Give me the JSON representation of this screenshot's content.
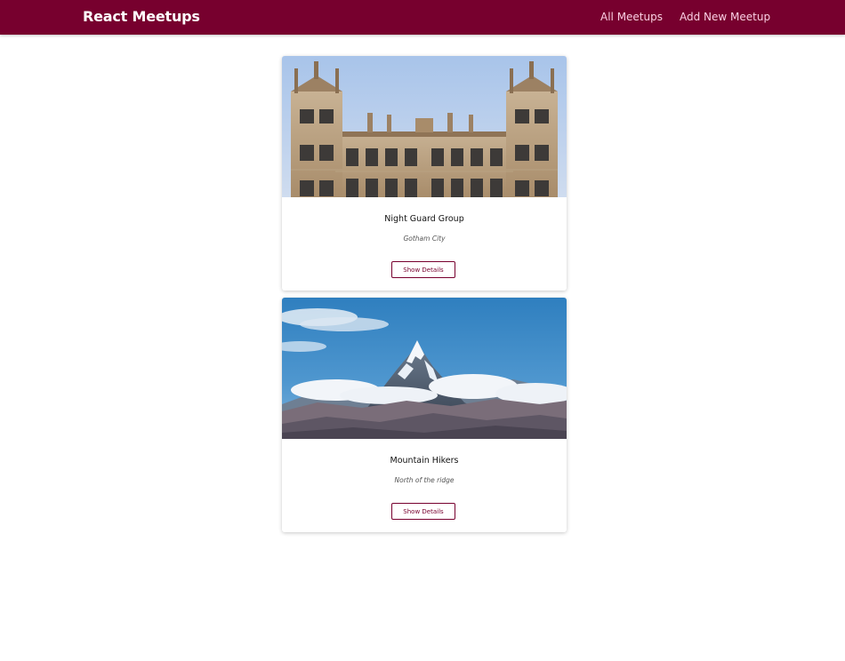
{
  "header": {
    "logo": "React Meetups",
    "nav": {
      "all_meetups": "All Meetups",
      "add_new_meetup": "Add New Meetup"
    }
  },
  "meetups": [
    {
      "title": "Night Guard Group",
      "address": "Gotham City",
      "button_label": "Show Details",
      "image_description": "castle-photo"
    },
    {
      "title": "Mountain Hikers",
      "address": "North of the ridge",
      "button_label": "Show Details",
      "image_description": "mountain-photo"
    }
  ],
  "colors": {
    "brand": "#77002e",
    "nav_text": "#fbcfe3",
    "background": "#ffffff"
  }
}
